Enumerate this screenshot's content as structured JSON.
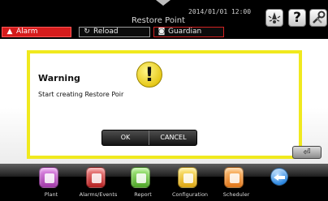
{
  "header": {
    "title": "Restore Point",
    "datetime": "2014/01/01  12:00",
    "buttons": [
      {
        "label": "Alarm",
        "icon": "bell-icon"
      },
      {
        "label": "Reload",
        "icon": "reload-icon"
      },
      {
        "label": "Guardian",
        "icon": "guardian-icon"
      }
    ],
    "icons": [
      "notification-icon",
      "help-icon",
      "tools-icon"
    ],
    "help_glyph": "?"
  },
  "dialog": {
    "title": "Warning",
    "message": "Start creating Restore Poir",
    "icon_glyph": "!",
    "ok_label": "OK",
    "cancel_label": "CANCEL"
  },
  "enter_glyph": "⏎",
  "colors": {
    "alarm": "#d51c1c",
    "dialog_border": "#f0e91e",
    "background": "#000000"
  },
  "nav": [
    {
      "label": "Plant",
      "icon": "plant-icon"
    },
    {
      "label": "Alarms/Events",
      "icon": "alarms-events-icon"
    },
    {
      "label": "Report",
      "icon": "report-icon"
    },
    {
      "label": "Configuration",
      "icon": "configuration-icon"
    },
    {
      "label": "Scheduler",
      "icon": "scheduler-icon"
    },
    {
      "label": "",
      "icon": "back-arrow-icon"
    }
  ]
}
